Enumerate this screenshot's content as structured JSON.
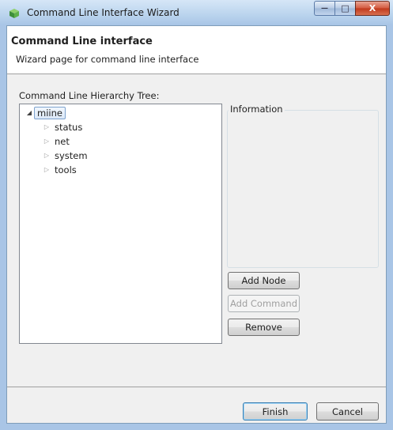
{
  "window": {
    "title": "Command Line Interface Wizard",
    "caption_buttons": {
      "minimize": "—",
      "maximize": "□",
      "close": "X"
    }
  },
  "header": {
    "title": "Command Line interface",
    "description": "Wizard page for command line interface"
  },
  "tree": {
    "label": "Command Line Hierarchy Tree:",
    "root": {
      "label": "miine",
      "expanded": true,
      "selected": true
    },
    "children": [
      {
        "label": "status"
      },
      {
        "label": "net"
      },
      {
        "label": "system"
      },
      {
        "label": "tools"
      }
    ]
  },
  "info": {
    "label": "Information"
  },
  "actions": {
    "add_node": "Add Node",
    "add_command": "Add Command",
    "remove": "Remove"
  },
  "footer": {
    "finish": "Finish",
    "cancel": "Cancel"
  },
  "colors": {
    "title_gradient": "#bcd5ee",
    "close_button": "#c0391c",
    "dialog_bg": "#f0f0f0",
    "selection_border": "#7da2ce"
  }
}
